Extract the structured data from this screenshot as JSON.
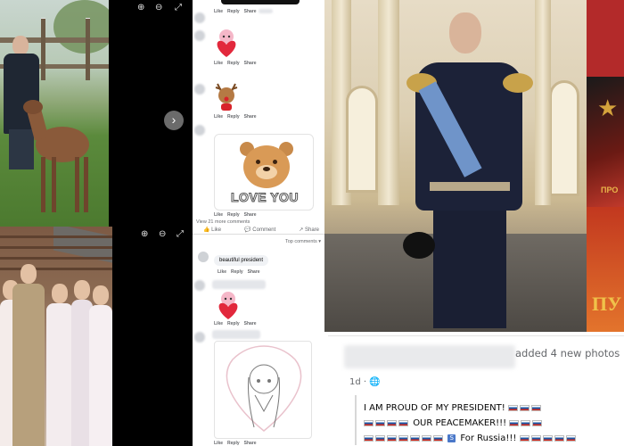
{
  "viewer": {
    "top_icons": [
      "zoom-in",
      "zoom-out",
      "fullscreen"
    ],
    "next_glyph": "›"
  },
  "comments_top": {
    "actions": [
      "Like",
      "Reply",
      "Share"
    ],
    "sticker_text": "LOVE YOU",
    "more_comments": "View 21 more comments",
    "react_like": "Like",
    "react_comment": "Comment",
    "react_share": "Share"
  },
  "comments_bottom": {
    "sort_label": "Top comments",
    "first_comment": "beautiful president",
    "actions": [
      "Like",
      "Reply",
      "Share"
    ]
  },
  "post": {
    "added_text": "added 4 new photos",
    "time": "1d · ",
    "line1": "I AM PROUD OF MY PRESIDENT!",
    "line2": "OUR PEACEMAKER!!!",
    "line3": "For Russia!!!",
    "flag_color_white": "#ffffff",
    "flag_color_blue": "#1c57a5",
    "flag_color_red": "#d52b1e"
  },
  "side_strip": {
    "partial_text": "ПУ",
    "partial_text_2": "ПРО"
  }
}
